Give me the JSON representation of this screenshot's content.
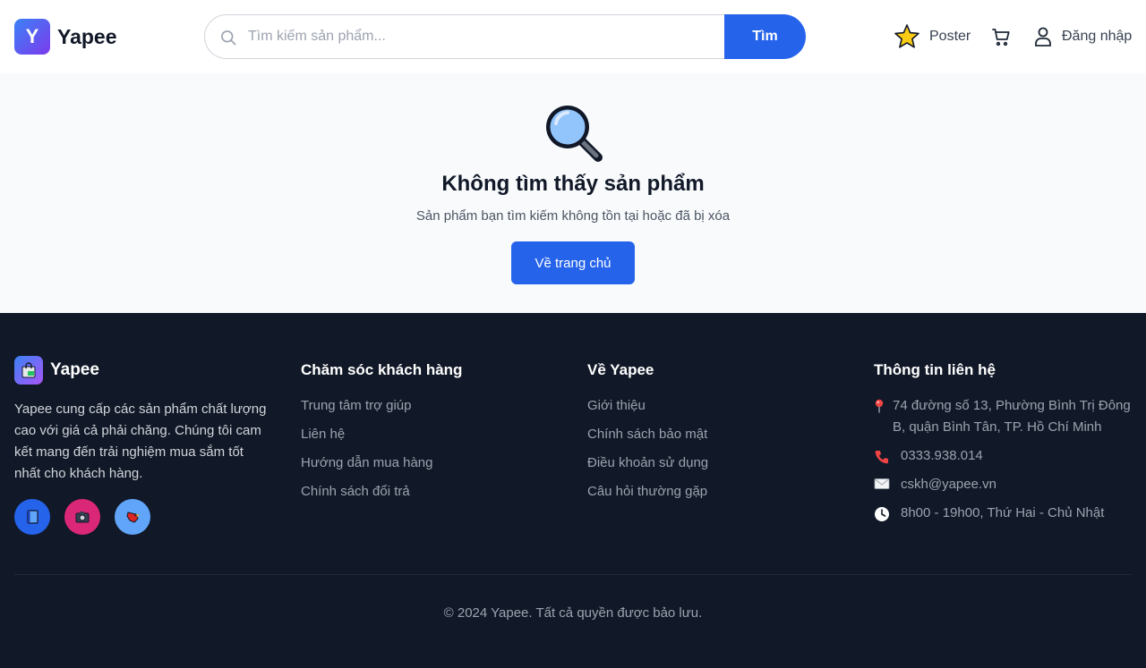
{
  "header": {
    "logo_letter": "Y",
    "brand": "Yapee",
    "search": {
      "placeholder": "Tìm kiếm sản phẩm...",
      "button_label": "Tìm"
    },
    "poster_label": "Poster",
    "login_label": "Đăng nhập"
  },
  "main": {
    "title": "Không tìm thấy sản phẩm",
    "subtitle": "Sản phẩm bạn tìm kiếm không tồn tại hoặc đã bị xóa",
    "home_button": "Về trang chủ"
  },
  "footer": {
    "brand": "Yapee",
    "description": "Yapee cung cấp các sản phẩm chất lượng cao với giá cả phải chăng. Chúng tôi cam kết mang đến trải nghiệm mua sắm tốt nhất cho khách hàng.",
    "customer_care": {
      "title": "Chăm sóc khách hàng",
      "links": [
        "Trung tâm trợ giúp",
        "Liên hệ",
        "Hướng dẫn mua hàng",
        "Chính sách đổi trả"
      ]
    },
    "about": {
      "title": "Về Yapee",
      "links": [
        "Giới thiệu",
        "Chính sách bảo mật",
        "Điều khoản sử dụng",
        "Câu hỏi thường gặp"
      ]
    },
    "contact": {
      "title": "Thông tin liên hệ",
      "address": "74 đường số 13, Phường Bình Trị Đông B, quận Bình Tân, TP. Hồ Chí Minh",
      "phone": "0333.938.014",
      "email": "cskh@yapee.vn",
      "hours": "8h00 - 19h00, Thứ Hai - Chủ Nhật"
    },
    "copyright": "© 2024 Yapee. Tất cả quyền được bảo lưu."
  },
  "colors": {
    "primary": "#2563eb",
    "footer_bg": "#111827",
    "page_bg": "#f8fafc",
    "social_1": "#2563eb",
    "social_2": "#db2777",
    "social_3": "#60a5fa"
  },
  "icons": [
    "search-icon",
    "star-icon",
    "cart-icon",
    "user-icon",
    "magnifier-icon",
    "shopping-bag-icon",
    "book-icon",
    "camera-icon",
    "bird-icon",
    "pin-icon",
    "phone-icon",
    "mail-icon",
    "clock-icon"
  ]
}
